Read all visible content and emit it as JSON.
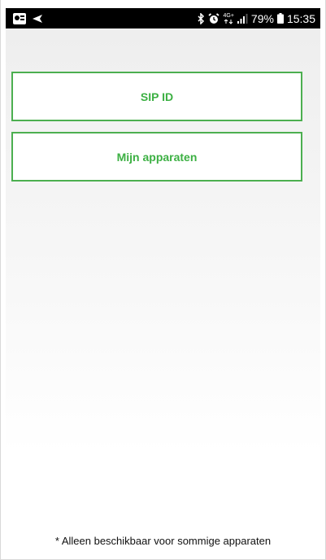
{
  "status_bar": {
    "battery": "79%",
    "time": "15:35",
    "network": "4G+",
    "icons": [
      "notification-icon",
      "send-icon",
      "bluetooth-icon",
      "alarm-icon",
      "network-icon",
      "signal-icon",
      "battery-icon"
    ]
  },
  "menu": {
    "buttons": [
      {
        "label": "SIP ID"
      },
      {
        "label": "Mijn apparaten"
      }
    ]
  },
  "footnote": "* Alleen beschikbaar voor sommige apparaten",
  "colors": {
    "accent": "#4caf50",
    "accent_text": "#3cb043",
    "status_bar": "#000000"
  }
}
